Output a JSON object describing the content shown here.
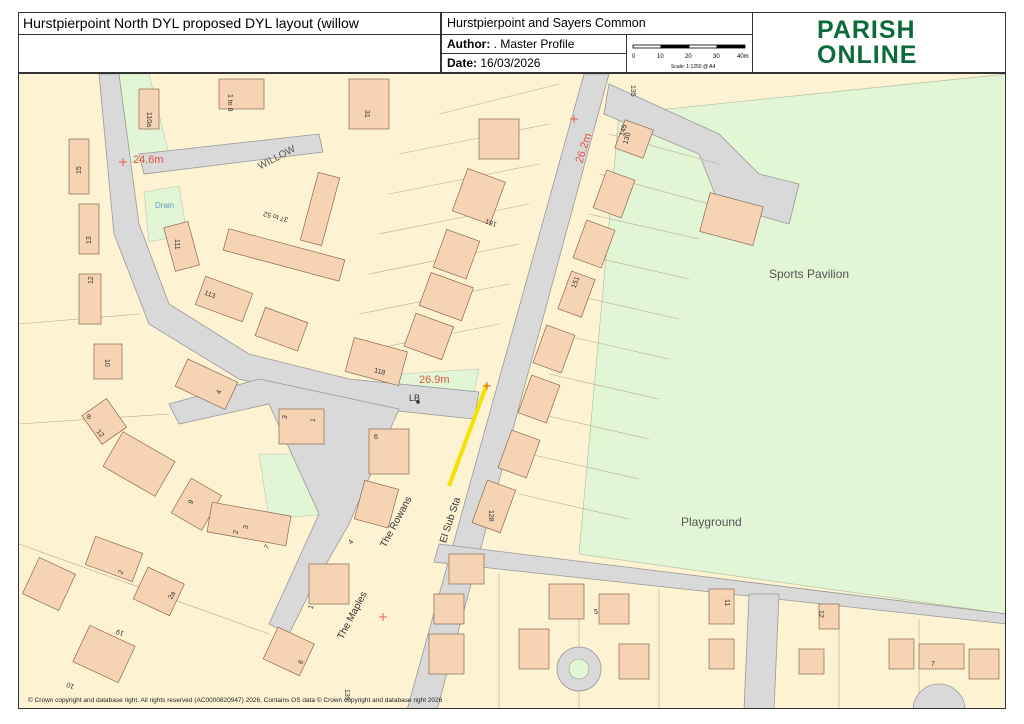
{
  "header": {
    "title": "Hurstpierpoint North DYL proposed DYL layout (willow",
    "parish": "Hurstpierpoint and Sayers Common",
    "author_label": "Author:",
    "author_value": ". Master Profile",
    "date_label": "Date:",
    "date_value": "16/03/2026",
    "scale_ticks": [
      "0",
      "10",
      "20",
      "30",
      "40m"
    ],
    "scale_text": "Scale: 1:1250 @ A4",
    "logo_line1": "PARISH",
    "logo_line2": "ONLINE"
  },
  "map": {
    "places": {
      "sports_pavilion": "Sports Pavilion",
      "playground": "Playground",
      "willow": "WILLOW",
      "el_sub_sta": "El Sub Sta",
      "the_rowans": "The Rowans",
      "the_maples": "The Maples",
      "drain": "Drain",
      "lb": "LB"
    },
    "spot_heights": [
      "24.6m",
      "26.2m",
      "26.9m"
    ],
    "house_numbers": [
      "1 to 8",
      "110a",
      "31",
      "15",
      "13",
      "12",
      "111",
      "37 to 52",
      "113",
      "161",
      "151",
      "10",
      "118",
      "4",
      "8",
      "12",
      "3",
      "1",
      "6",
      "9",
      "3",
      "2",
      "7",
      "4",
      "1",
      "2",
      "2a",
      "19",
      "6",
      "10",
      "139",
      "128",
      "135",
      "145",
      "130",
      "5",
      "11",
      "12",
      "7"
    ],
    "colors": {
      "land": "#fdf3d3",
      "building": "#f6d3b3",
      "road": "#d9d9d9",
      "green": "#e2f5d4",
      "dyl": "#f5e100",
      "label_red": "#e2533d"
    }
  },
  "footer": {
    "copyright": "© Crown copyright and database right. All rights reserved (AC0000820947) 2026, Contains OS data © Crown copyright and database right 2026"
  }
}
